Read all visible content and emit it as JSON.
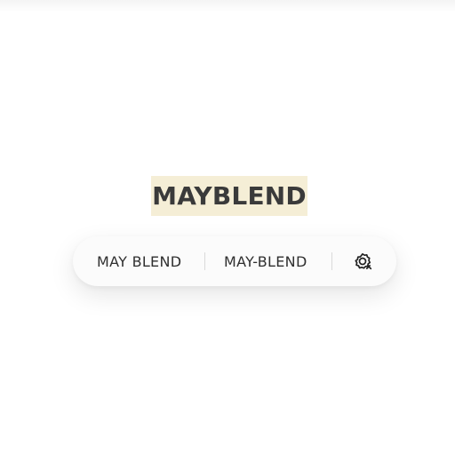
{
  "selected_word": "MAYBLEND",
  "suggestions": [
    {
      "label": "MAY BLEND"
    },
    {
      "label": "MAY-BLEND"
    }
  ],
  "icons": {
    "action": "settings-sparkle-icon"
  },
  "colors": {
    "highlight": "#f5eed6",
    "text": "#2f2f2f",
    "bar_background": "#fbfbfb",
    "divider": "#dadada"
  }
}
